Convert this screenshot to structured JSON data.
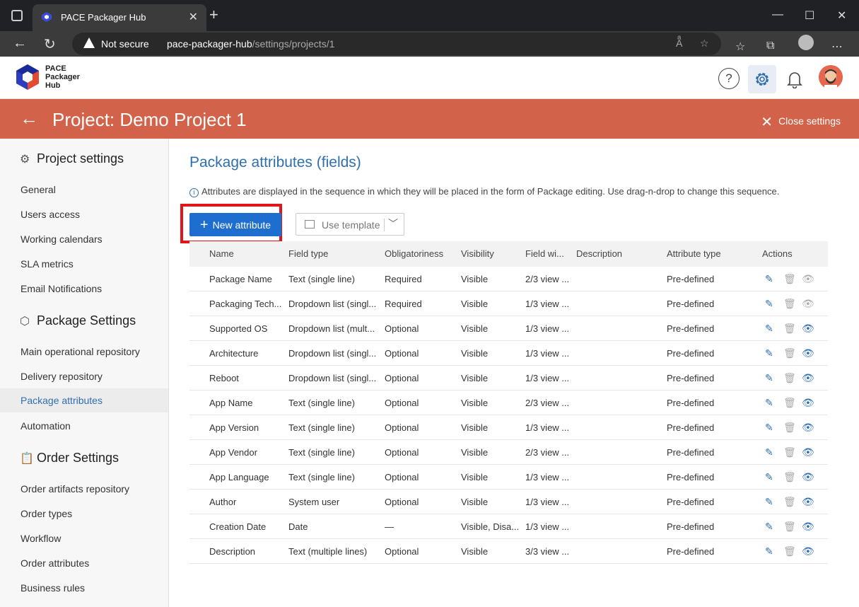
{
  "browser": {
    "tab_title": "PACE Packager Hub",
    "security_label": "Not secure",
    "url_host": "pace-packager-hub",
    "url_path": "/settings/projects/1"
  },
  "app": {
    "logo_lines": [
      "PACE",
      "Packager",
      "Hub"
    ]
  },
  "banner": {
    "title": "Project: Demo Project 1",
    "close_label": "Close settings"
  },
  "sidebar": {
    "project_settings_title": "Project settings",
    "project_items": [
      "General",
      "Users access",
      "Working calendars",
      "SLA metrics",
      "Email Notifications"
    ],
    "package_settings_title": "Package Settings",
    "package_items": [
      "Main operational repository",
      "Delivery repository",
      "Package attributes",
      "Automation"
    ],
    "order_settings_title": "Order Settings",
    "order_items": [
      "Order artifacts repository",
      "Order types",
      "Workflow",
      "Order attributes",
      "Business rules"
    ],
    "active_item": "Package attributes"
  },
  "main": {
    "title": "Package attributes (fields)",
    "hint": "Attributes are displayed in the sequence in which they will be placed in the form of Package editing. Use drag-n-drop to change this sequence.",
    "new_button": "New attribute",
    "template_button": "Use template"
  },
  "table": {
    "columns": [
      "Name",
      "Field type",
      "Obligatoriness",
      "Visibility",
      "Field wi...",
      "Description",
      "Attribute type",
      "Actions"
    ],
    "rows": [
      {
        "name": "Package Name",
        "type": "Text (single line)",
        "obl": "Required",
        "vis": "Visible",
        "fw": "2/3 view ...",
        "desc": "",
        "at": "Pre-defined",
        "eye_dim": true
      },
      {
        "name": "Packaging Tech...",
        "type": "Dropdown list (singl...",
        "obl": "Required",
        "vis": "Visible",
        "fw": "1/3 view ...",
        "desc": "",
        "at": "Pre-defined",
        "eye_dim": true
      },
      {
        "name": "Supported OS",
        "type": "Dropdown list (mult...",
        "obl": "Optional",
        "vis": "Visible",
        "fw": "1/3 view ...",
        "desc": "",
        "at": "Pre-defined",
        "eye_dim": false
      },
      {
        "name": "Architecture",
        "type": "Dropdown list (singl...",
        "obl": "Optional",
        "vis": "Visible",
        "fw": "1/3 view ...",
        "desc": "",
        "at": "Pre-defined",
        "eye_dim": false
      },
      {
        "name": "Reboot",
        "type": "Dropdown list (singl...",
        "obl": "Optional",
        "vis": "Visible",
        "fw": "1/3 view ...",
        "desc": "",
        "at": "Pre-defined",
        "eye_dim": false
      },
      {
        "name": "App Name",
        "type": "Text (single line)",
        "obl": "Optional",
        "vis": "Visible",
        "fw": "2/3 view ...",
        "desc": "",
        "at": "Pre-defined",
        "eye_dim": false
      },
      {
        "name": "App Version",
        "type": "Text (single line)",
        "obl": "Optional",
        "vis": "Visible",
        "fw": "1/3 view ...",
        "desc": "",
        "at": "Pre-defined",
        "eye_dim": false
      },
      {
        "name": "App Vendor",
        "type": "Text (single line)",
        "obl": "Optional",
        "vis": "Visible",
        "fw": "2/3 view ...",
        "desc": "",
        "at": "Pre-defined",
        "eye_dim": false
      },
      {
        "name": "App Language",
        "type": "Text (single line)",
        "obl": "Optional",
        "vis": "Visible",
        "fw": "1/3 view ...",
        "desc": "",
        "at": "Pre-defined",
        "eye_dim": false
      },
      {
        "name": "Author",
        "type": "System user",
        "obl": "Optional",
        "vis": "Visible",
        "fw": "1/3 view ...",
        "desc": "",
        "at": "Pre-defined",
        "eye_dim": false
      },
      {
        "name": "Creation Date",
        "type": "Date",
        "obl": "—",
        "vis": "Visible, Disa...",
        "fw": "1/3 view ...",
        "desc": "",
        "at": "Pre-defined",
        "eye_dim": false
      },
      {
        "name": "Description",
        "type": "Text (multiple lines)",
        "obl": "Optional",
        "vis": "Visible",
        "fw": "3/3 view ...",
        "desc": "",
        "at": "Pre-defined",
        "eye_dim": false
      }
    ]
  },
  "colors": {
    "banner": "#d2634a",
    "accent": "#2f6fb0",
    "primary_button": "#1e6ecf",
    "highlight_box": "#e0161b"
  }
}
